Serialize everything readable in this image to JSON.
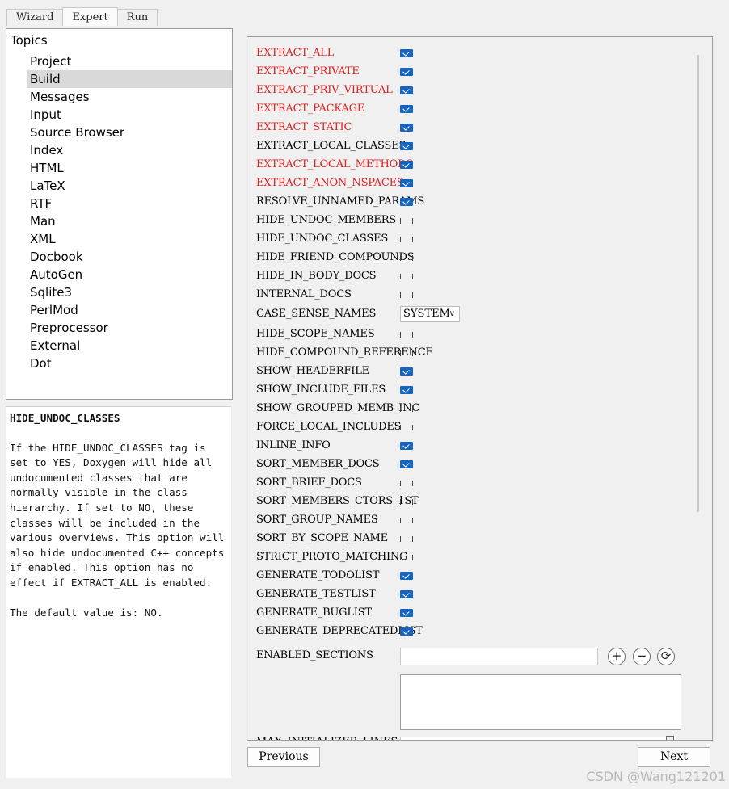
{
  "tabs": [
    {
      "label": "Wizard",
      "active": false
    },
    {
      "label": "Expert",
      "active": true
    },
    {
      "label": "Run",
      "active": false
    }
  ],
  "topics": {
    "root": "Topics",
    "selected": "Build",
    "items": [
      "Project",
      "Build",
      "Messages",
      "Input",
      "Source Browser",
      "Index",
      "HTML",
      "LaTeX",
      "RTF",
      "Man",
      "XML",
      "Docbook",
      "AutoGen",
      "Sqlite3",
      "PerlMod",
      "Preprocessor",
      "External",
      "Dot"
    ]
  },
  "help": {
    "title": "HIDE_UNDOC_CLASSES",
    "body": "If the HIDE_UNDOC_CLASSES tag is set to YES, Doxygen will hide all undocumented classes that are normally visible in the class hierarchy. If set to NO, these classes will be included in the various overviews. This option will also hide undocumented C++ concepts if enabled. This option has no effect if EXTRACT_ALL is enabled.",
    "default": "The default value is: NO."
  },
  "settings": [
    {
      "name": "EXTRACT_ALL",
      "type": "bool",
      "checked": true,
      "changed": true
    },
    {
      "name": "EXTRACT_PRIVATE",
      "type": "bool",
      "checked": true,
      "changed": true
    },
    {
      "name": "EXTRACT_PRIV_VIRTUAL",
      "type": "bool",
      "checked": true,
      "changed": true
    },
    {
      "name": "EXTRACT_PACKAGE",
      "type": "bool",
      "checked": true,
      "changed": true
    },
    {
      "name": "EXTRACT_STATIC",
      "type": "bool",
      "checked": true,
      "changed": true
    },
    {
      "name": "EXTRACT_LOCAL_CLASSES",
      "type": "bool",
      "checked": true,
      "changed": false
    },
    {
      "name": "EXTRACT_LOCAL_METHODS",
      "type": "bool",
      "checked": true,
      "changed": true
    },
    {
      "name": "EXTRACT_ANON_NSPACES",
      "type": "bool",
      "checked": true,
      "changed": true
    },
    {
      "name": "RESOLVE_UNNAMED_PARAMS",
      "type": "bool",
      "checked": true,
      "changed": false
    },
    {
      "name": "HIDE_UNDOC_MEMBERS",
      "type": "bool",
      "checked": false,
      "changed": false
    },
    {
      "name": "HIDE_UNDOC_CLASSES",
      "type": "bool",
      "checked": false,
      "changed": false
    },
    {
      "name": "HIDE_FRIEND_COMPOUNDS",
      "type": "bool",
      "checked": false,
      "changed": false
    },
    {
      "name": "HIDE_IN_BODY_DOCS",
      "type": "bool",
      "checked": false,
      "changed": false
    },
    {
      "name": "INTERNAL_DOCS",
      "type": "bool",
      "checked": false,
      "changed": false
    },
    {
      "name": "CASE_SENSE_NAMES",
      "type": "enum",
      "value": "SYSTEM",
      "changed": false
    },
    {
      "name": "HIDE_SCOPE_NAMES",
      "type": "bool",
      "checked": false,
      "changed": false
    },
    {
      "name": "HIDE_COMPOUND_REFERENCE",
      "type": "bool",
      "checked": false,
      "changed": false
    },
    {
      "name": "SHOW_HEADERFILE",
      "type": "bool",
      "checked": true,
      "changed": false
    },
    {
      "name": "SHOW_INCLUDE_FILES",
      "type": "bool",
      "checked": true,
      "changed": false
    },
    {
      "name": "SHOW_GROUPED_MEMB_INC",
      "type": "bool",
      "checked": false,
      "changed": false
    },
    {
      "name": "FORCE_LOCAL_INCLUDES",
      "type": "bool",
      "checked": false,
      "changed": false
    },
    {
      "name": "INLINE_INFO",
      "type": "bool",
      "checked": true,
      "changed": false
    },
    {
      "name": "SORT_MEMBER_DOCS",
      "type": "bool",
      "checked": true,
      "changed": false
    },
    {
      "name": "SORT_BRIEF_DOCS",
      "type": "bool",
      "checked": false,
      "changed": false
    },
    {
      "name": "SORT_MEMBERS_CTORS_1ST",
      "type": "bool",
      "checked": false,
      "changed": false
    },
    {
      "name": "SORT_GROUP_NAMES",
      "type": "bool",
      "checked": false,
      "changed": false
    },
    {
      "name": "SORT_BY_SCOPE_NAME",
      "type": "bool",
      "checked": false,
      "changed": false
    },
    {
      "name": "STRICT_PROTO_MATCHING",
      "type": "bool",
      "checked": false,
      "changed": false
    },
    {
      "name": "GENERATE_TODOLIST",
      "type": "bool",
      "checked": true,
      "changed": false
    },
    {
      "name": "GENERATE_TESTLIST",
      "type": "bool",
      "checked": true,
      "changed": false
    },
    {
      "name": "GENERATE_BUGLIST",
      "type": "bool",
      "checked": true,
      "changed": false
    },
    {
      "name": "GENERATE_DEPRECATEDLIST",
      "type": "bool",
      "checked": true,
      "changed": false
    }
  ],
  "enabled_sections": {
    "label": "ENABLED_SECTIONS",
    "value": "",
    "buttons": [
      {
        "icon": "plus-icon",
        "glyph": "+"
      },
      {
        "icon": "minus-icon",
        "glyph": "−"
      },
      {
        "icon": "refresh-icon",
        "glyph": "⟳"
      }
    ]
  },
  "cut_off_label": "MAX_INITIALIZER_LINES",
  "buttons": {
    "previous": "Previous",
    "next": "Next"
  },
  "watermark": "CSDN @Wang121201",
  "colors": {
    "changed_label": "#e02020",
    "checkbox_on": "#1565c0",
    "selected_topic": "#d9d9d9"
  }
}
